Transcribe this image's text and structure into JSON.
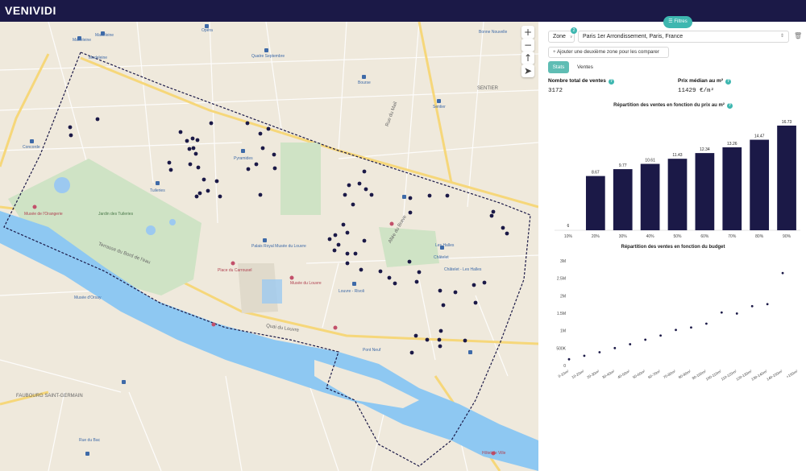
{
  "app": {
    "logo": "VENIVIDI",
    "filters_label": "Filtres",
    "filters_icon": "sliders-icon"
  },
  "map": {
    "controls": [
      "+",
      "−",
      "↑",
      "➤"
    ],
    "labels": {
      "madeleine": "Madeleine",
      "madeleine2": "Madeleine",
      "opera": "Opéra",
      "quatre_septembre": "Quatre Septembre",
      "bourse": "Bourse",
      "bonne_nouvelle": "Bonne Nouvelle",
      "sentier": "SENTIER",
      "sentier_metro": "Sentier",
      "concorde": "Concorde",
      "tuileries": "Tuileries",
      "pyramides": "Pyramides",
      "jardin_tuileries": "Jardin des Tuileries",
      "orangerie": "Musée de l'Orangerie",
      "terrasse": "Terrasse du Bord de l'eau",
      "palais_royal": "Palais Royal Musée du Louvre",
      "louvre_pyramid": "Pyramide du Louvre",
      "musee_louvre": "Musée du Louvre",
      "place_carrousel": "Place du Carrousel",
      "orsay": "Musée d'Orsay",
      "louvre_rivoli": "Louvre - Rivoli",
      "chatelet": "Châtelet",
      "les_halles": "Les Halles",
      "chatelet_les_halles": "Châtelet - Les Halles",
      "pont_neuf": "Pont Neuf",
      "quai_louvre": "Quai du Louvre",
      "saint_germain": "FAUBOURG SAINT-GERMAIN",
      "bac": "Rue du Bac",
      "rue_mail": "Rue du Mail",
      "rue_halles": "Allée du Brave",
      "hotel_paris": "Hôtel de Ville"
    }
  },
  "panel": {
    "zone_label": "Zone",
    "zone_badge": "2",
    "zone_value": "Paris 1er Arrondissement, Paris, France",
    "add_zone": "Ajouter une deuxième zone pour les comparer",
    "tabs": [
      "Stats",
      "Ventes"
    ],
    "total_sales_title": "Nombre total de ventes",
    "total_sales_value": "3172",
    "median_price_title": "Prix médian au m²",
    "median_price_value": "11429 €/m²"
  },
  "chart_data": [
    {
      "type": "bar",
      "title": "Répartition des ventes en fonction du prix au m²",
      "categories": [
        "10%",
        "20%",
        "30%",
        "40%",
        "50%",
        "60%",
        "70%",
        "80%",
        "90%"
      ],
      "values": [
        6,
        8.67,
        9.77,
        10.61,
        11.43,
        12.34,
        13.26,
        14.47,
        16.73
      ],
      "data_labels": [
        "6",
        "8.67",
        "9.77",
        "10.61",
        "11.43",
        "12.34",
        "13.26",
        "14.47",
        "16.73"
      ],
      "bar_color": "#1b1947"
    },
    {
      "type": "scatter",
      "title": "Répartition des ventes en fonction du budget",
      "categories": [
        "0-10m²",
        "10-20m²",
        "20-30m²",
        "30-40m²",
        "40-50m²",
        "50-60m²",
        "60-70m²",
        "70-80m²",
        "80-90m²",
        "90-100m²",
        "100-110m²",
        "110-120m²",
        "120-130m²",
        "130-140m²",
        "140-150m²",
        "+150m²"
      ],
      "values": [
        180000,
        280000,
        380000,
        500000,
        610000,
        740000,
        860000,
        1020000,
        1090000,
        1200000,
        1520000,
        1490000,
        1700000,
        1760000,
        2650000
      ],
      "yticks": [
        "0",
        "500K",
        "1M",
        "1.5M",
        "2M",
        "2.5M",
        "3M"
      ],
      "ylim": [
        0,
        3000000
      ]
    }
  ]
}
